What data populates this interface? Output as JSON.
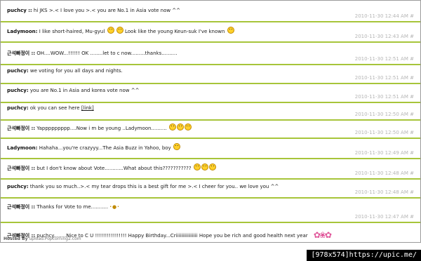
{
  "comments": [
    {
      "author": "puchcy",
      "sep": "::",
      "text": "hi JKS >.< I love you >.< you are No.1 in Asia vote now ^^",
      "date": "2010-11-30 12:44 AM",
      "perm": "#"
    },
    {
      "author": "Ladymoon:",
      "sep": "",
      "text_a": "I like short-haired, Mu-gyul",
      "text_b": "Look like the young Keun-suk I've known",
      "date": "2010-11-30 12:43 AM",
      "perm": "#"
    },
    {
      "author": "근석빠정이",
      "sep": "::",
      "text": "OH....WOW...!!!!!! OK ........let to c now.........thanks..........",
      "date": "2010-11-30 12:51 AM",
      "perm": "#"
    },
    {
      "author": "puchcy:",
      "sep": "",
      "text": "we voting for you all days and nights.",
      "date": "2010-11-30 12:51 AM",
      "perm": "#"
    },
    {
      "author": "puchcy:",
      "sep": "",
      "text": "you are No.1 in Asia and korea vote now ^^",
      "date": "2010-11-30 12:51 AM",
      "perm": "#"
    },
    {
      "author": "puchcy:",
      "sep": "",
      "text": "ok you can see here",
      "link": "[link]",
      "date": "2010-11-30 12:50 AM",
      "perm": "#"
    },
    {
      "author": "근석빠정이",
      "sep": "::",
      "text": "Yappppppppp....Now i m be young ..Ladymoon..........",
      "date": "2010-11-30 12:50 AM",
      "perm": "#"
    },
    {
      "author": "Ladymoon:",
      "sep": "",
      "text": "Hahaha...you're crazyyy...The Asia Buzz in Yahoo, boy",
      "date": "2010-11-30 12:49 AM",
      "perm": "#"
    },
    {
      "author": "근석빠정이",
      "sep": "::",
      "text": "but I don't know about Vote............What about this???????????",
      "date": "2010-11-30 12:48 AM",
      "perm": "#"
    },
    {
      "author": "puchcy:",
      "sep": "",
      "text": "thank you so much..>.< my tear drops this is a best gift for me >.< I cheer for you.. we love you ^^",
      "date": "2010-11-30 12:48 AM",
      "perm": "#"
    },
    {
      "author": "근석빠정이",
      "sep": "::",
      "text": "Thanks for Vote to me...........",
      "date": "2010-11-30 12:47 AM",
      "perm": "#"
    },
    {
      "author": "근석빠정이",
      "sep": "::",
      "text": "puchcy........Nice to C U !!!!!!!!!!!!!!!! Happy Birthday...Criiiiiiiiiiiiiiii Hope you be rich and good health next year",
      "date": "",
      "perm": ""
    }
  ],
  "footer": {
    "hosted_by": "Hosted By",
    "host": "upload.Popcorning2.com"
  },
  "stamp": "[978x574]https://upic.me/",
  "colors": {
    "rule": "#a7c53a",
    "meta": "#b5b5b5",
    "smiley": "#ffd02a"
  },
  "icons": [
    "smiley-icon",
    "flowers-icon"
  ]
}
